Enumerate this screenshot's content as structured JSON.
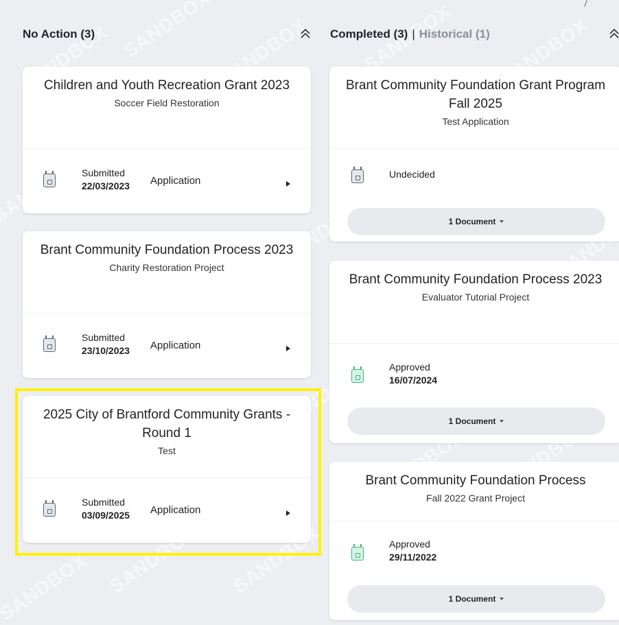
{
  "watermark": "SANDBOX",
  "left_column": {
    "title": "No Action (3)",
    "collapse_icon": "double-chevron-up-icon",
    "cards": [
      {
        "title": "Children and Youth Recreation Grant 2023",
        "subtitle": "Soccer Field Restoration",
        "status": "Submitted",
        "date": "22/03/2023",
        "type": "Application"
      },
      {
        "title": "Brant Community Foundation Process 2023",
        "subtitle": "Charity Restoration Project",
        "status": "Submitted",
        "date": "23/10/2023",
        "type": "Application"
      },
      {
        "title": "2025 City of Brantford Community Grants - Round 1",
        "subtitle": "Test",
        "status": "Submitted",
        "date": "03/09/2025",
        "type": "Application"
      }
    ]
  },
  "right_column": {
    "completed_label": "Completed (3)",
    "separator": "|",
    "historical_label": "Historical (1)",
    "collapse_icon": "double-chevron-up-icon",
    "cards": [
      {
        "title": "Brant Community Foundation Grant Program Fall 2025",
        "subtitle": "Test Application",
        "status": "Undecided",
        "date": "",
        "documents": "1 Document"
      },
      {
        "title": "Brant Community Foundation Process 2023",
        "subtitle": "Evaluator Tutorial Project",
        "status": "Approved",
        "date": "16/07/2024",
        "documents": "1 Document"
      },
      {
        "title": "Brant Community Foundation Process",
        "subtitle": "Fall 2022 Grant Project",
        "status": "Approved",
        "date": "29/11/2022",
        "documents": "1 Document"
      }
    ]
  },
  "colors": {
    "highlight": "#fff200",
    "approved": "#3fb57f",
    "neutral_icon": "#5b6570",
    "historical": "#8a8f98"
  }
}
